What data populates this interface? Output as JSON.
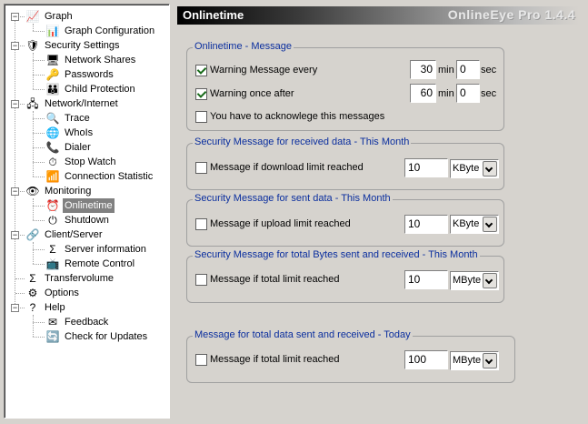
{
  "tree": [
    {
      "label": "Graph",
      "icon": "graph-icon",
      "glyph": "📈",
      "level": 0,
      "expander": "−"
    },
    {
      "label": "Graph Configuration",
      "icon": "chart-config-icon",
      "glyph": "📊",
      "level": 1
    },
    {
      "label": "Security Settings",
      "icon": "ip-shield-icon",
      "glyph": "🛡",
      "level": 0,
      "expander": "−"
    },
    {
      "label": "Network Shares",
      "icon": "computer-icon",
      "glyph": "🖥",
      "level": 1
    },
    {
      "label": "Passwords",
      "icon": "keys-icon",
      "glyph": "🔑",
      "level": 1
    },
    {
      "label": "Child Protection",
      "icon": "child-icon",
      "glyph": "👪",
      "level": 1
    },
    {
      "label": "Network/Internet",
      "icon": "network-icon",
      "glyph": "🖧",
      "level": 0,
      "expander": "−"
    },
    {
      "label": "Trace",
      "icon": "trace-icon",
      "glyph": "🔍",
      "level": 1
    },
    {
      "label": "WhoIs",
      "icon": "globe-icon",
      "glyph": "🌐",
      "level": 1
    },
    {
      "label": "Dialer",
      "icon": "dialer-icon",
      "glyph": "📞",
      "level": 1
    },
    {
      "label": "Stop Watch",
      "icon": "stopwatch-icon",
      "glyph": "⏱",
      "level": 1
    },
    {
      "label": "Connection Statistic",
      "icon": "statistic-icon",
      "glyph": "📶",
      "level": 1
    },
    {
      "label": "Monitoring",
      "icon": "monitoring-icon",
      "glyph": "👁",
      "level": 0,
      "expander": "−"
    },
    {
      "label": "Onlinetime",
      "icon": "alarm-clock-icon",
      "glyph": "⏰",
      "level": 1,
      "selected": true
    },
    {
      "label": "Shutdown",
      "icon": "shutdown-icon",
      "glyph": "⏻",
      "level": 1
    },
    {
      "label": "Client/Server",
      "icon": "client-server-icon",
      "glyph": "🔗",
      "level": 0,
      "expander": "−"
    },
    {
      "label": "Server information",
      "icon": "sigma-icon",
      "glyph": "Σ",
      "level": 1
    },
    {
      "label": "Remote Control",
      "icon": "remote-control-icon",
      "glyph": "📺",
      "level": 1
    },
    {
      "label": "Transfervolume",
      "icon": "sigma-icon",
      "glyph": "Σ",
      "level": 0
    },
    {
      "label": "Options",
      "icon": "options-icon",
      "glyph": "⚙",
      "level": 0
    },
    {
      "label": "Help",
      "icon": "help-icon",
      "glyph": "?",
      "level": 0,
      "expander": "−"
    },
    {
      "label": "Feedback",
      "icon": "envelope-icon",
      "glyph": "✉",
      "level": 1
    },
    {
      "label": "Check for Updates",
      "icon": "update-icon",
      "glyph": "🔄",
      "level": 1
    }
  ],
  "header": {
    "title": "Onlinetime",
    "brand": "OnlineEye Pro 1.4.4"
  },
  "groups": {
    "message": {
      "title": "Onlinetime - Message",
      "warning_every": {
        "label": "Warning Message every",
        "checked": true,
        "min": "30",
        "min_label": "min",
        "sec": "0",
        "sec_label": "sec"
      },
      "warning_once": {
        "label": "Warning once after",
        "checked": true,
        "min": "60",
        "min_label": "min",
        "sec": "0",
        "sec_label": "sec"
      },
      "acknowledge": {
        "label": "You have to acknowlege this messages",
        "checked": false
      }
    },
    "received": {
      "title": "Security Message for received data - This Month",
      "label": "Message if download limit reached",
      "checked": false,
      "value": "10",
      "unit": "KByte"
    },
    "sent": {
      "title": "Security Message for sent data - This Month",
      "label": "Message if upload limit reached",
      "checked": false,
      "value": "10",
      "unit": "KByte"
    },
    "total_month": {
      "title": "Security Message for total Bytes sent and received - This Month",
      "label": "Message if total limit reached",
      "checked": false,
      "value": "10",
      "unit": "MByte"
    },
    "total_today": {
      "title": "Message for total data sent and received - Today",
      "label": "Message if total limit reached",
      "checked": false,
      "value": "100",
      "unit": "MByte"
    }
  }
}
